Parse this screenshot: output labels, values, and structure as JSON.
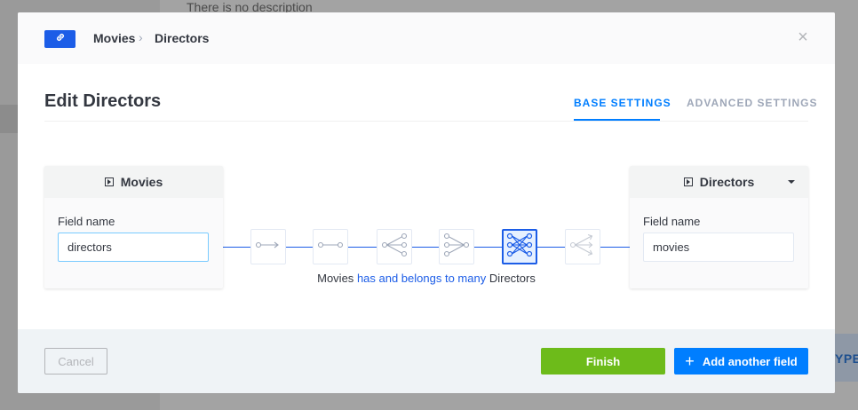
{
  "background": {
    "description_text": "There is no description",
    "type_fragment": "YPE"
  },
  "modal": {
    "header": {
      "badge_icon": "link-icon",
      "breadcrumb": [
        "Movies",
        "Directors"
      ],
      "breadcrumb_separator": "›",
      "close_icon": "×"
    },
    "title": "Edit Directors",
    "tabs": [
      {
        "label": "BASE SETTINGS",
        "active": true
      },
      {
        "label": "ADVANCED SETTINGS",
        "active": false
      }
    ],
    "left_model": {
      "name": "Movies",
      "field_label": "Field name",
      "field_value": "directors"
    },
    "right_model": {
      "name": "Directors",
      "field_label": "Field name",
      "field_value": "movies"
    },
    "relations": [
      {
        "icon": "one-way-relation-icon",
        "active": false
      },
      {
        "icon": "one-to-one-relation-icon",
        "active": false
      },
      {
        "icon": "one-to-many-relation-icon",
        "active": false
      },
      {
        "icon": "many-to-one-relation-icon",
        "active": false
      },
      {
        "icon": "many-to-many-relation-icon",
        "active": true
      },
      {
        "icon": "many-way-relation-icon",
        "active": false
      }
    ],
    "relation_sentence": {
      "left": "Movies",
      "relation": "has and belongs to many",
      "right": "Directors"
    },
    "footer": {
      "cancel_label": "Cancel",
      "finish_label": "Finish",
      "add_label": "Add another field",
      "add_icon": "+"
    },
    "colors": {
      "primary": "#007eff",
      "relation_blue": "#1c5de7",
      "finish_green": "#6dbb1a"
    }
  }
}
